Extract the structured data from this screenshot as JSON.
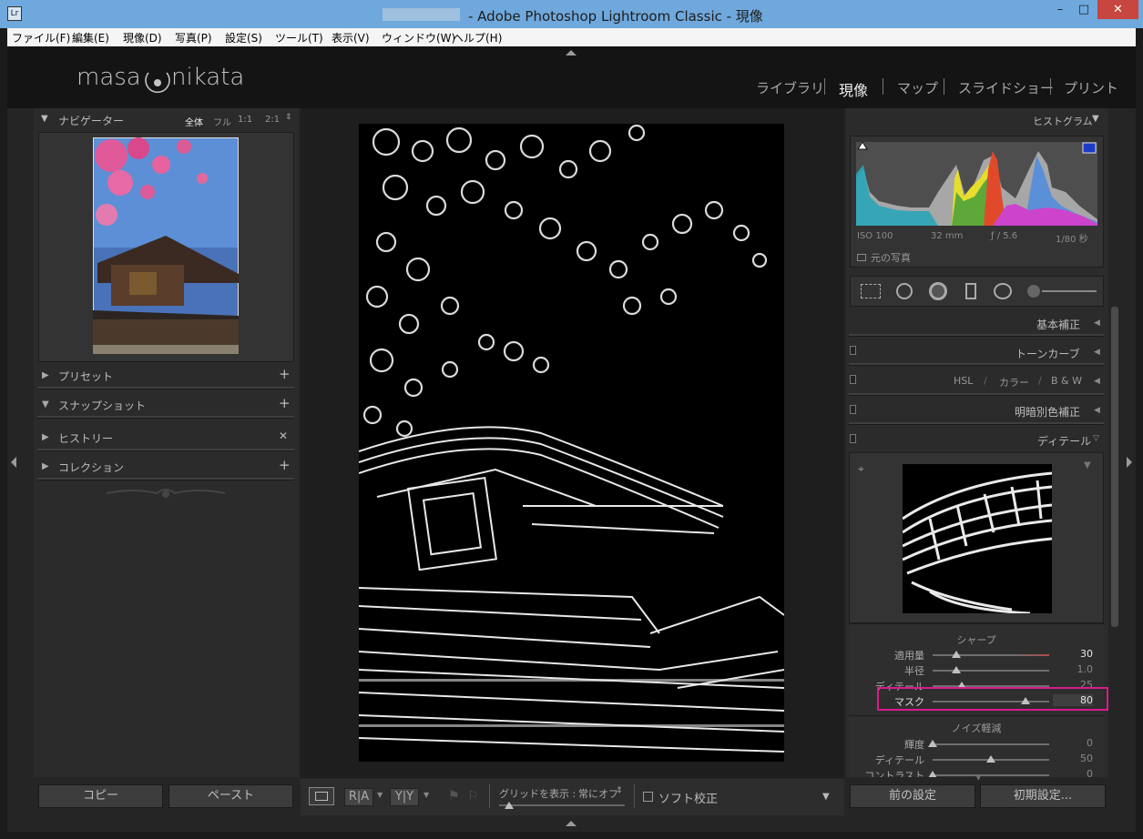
{
  "window": {
    "app_icon": "Lr",
    "title": "- Adobe Photoshop Lightroom Classic - 現像",
    "minimize": "–",
    "maximize": "□",
    "close": "✕"
  },
  "menu": [
    "ファイル(F)",
    "編集(E)",
    "現像(D)",
    "写真(P)",
    "設定(S)",
    "ツール(T)",
    "表示(V)",
    "ウィンドウ(W)",
    "ヘルプ(H)"
  ],
  "identity": {
    "logo_left": "masa",
    "logo_right": "nikata"
  },
  "modules": [
    "ライブラリ",
    "現像",
    "マップ",
    "スライドショー",
    "プリント"
  ],
  "navigator": {
    "title": "ナビゲーター",
    "zoom": [
      "全体",
      "フル",
      "1:1",
      "2:1"
    ]
  },
  "left_sections": [
    {
      "label": "プリセット",
      "action": "+"
    },
    {
      "label": "スナップショット",
      "action": "+"
    },
    {
      "label": "ヒストリー",
      "action": "✕"
    },
    {
      "label": "コレクション",
      "action": "+"
    }
  ],
  "left_buttons": {
    "copy": "コピー",
    "paste": "ペースト"
  },
  "histogram": {
    "title": "ヒストグラム",
    "iso": "ISO 100",
    "focal": "32 mm",
    "aperture": "ƒ / 5.6",
    "shutter": "1/80 秒",
    "original": "元の写真"
  },
  "right_sections": {
    "basic": "基本補正",
    "tone": "トーンカーブ",
    "hsl": "HSL",
    "color": "カラー",
    "bw": "B & W",
    "split": "明暗別色補正",
    "detail": "ディテール"
  },
  "sharpen": {
    "title": "シャープ",
    "rows": [
      {
        "label": "適用量",
        "value": "30",
        "level": 0.2
      },
      {
        "label": "半径",
        "value": "1.0",
        "level": 0.2
      },
      {
        "label": "ディテール",
        "value": "25",
        "level": 0.25
      },
      {
        "label": "マスク",
        "value": "80",
        "level": 0.8
      }
    ]
  },
  "noise": {
    "title": "ノイズ軽減",
    "rows": [
      {
        "label": "輝度",
        "value": "0",
        "level": 0.0
      },
      {
        "label": "ディテール",
        "value": "50",
        "level": 0.5
      },
      {
        "label": "コントラスト",
        "value": "0",
        "level": 0.0
      }
    ]
  },
  "right_buttons": {
    "prev": "前の設定",
    "reset": "初期設定..."
  },
  "toolbar": {
    "ra": "R|A",
    "yy": "Y|Y",
    "grid_label": "グリッドを表示 :",
    "grid_value": "常にオフ",
    "soft_proof": "ソフト校正"
  },
  "colors": {
    "highlight_box": "#d81b8c",
    "title_bar": "#6fa8dc"
  }
}
